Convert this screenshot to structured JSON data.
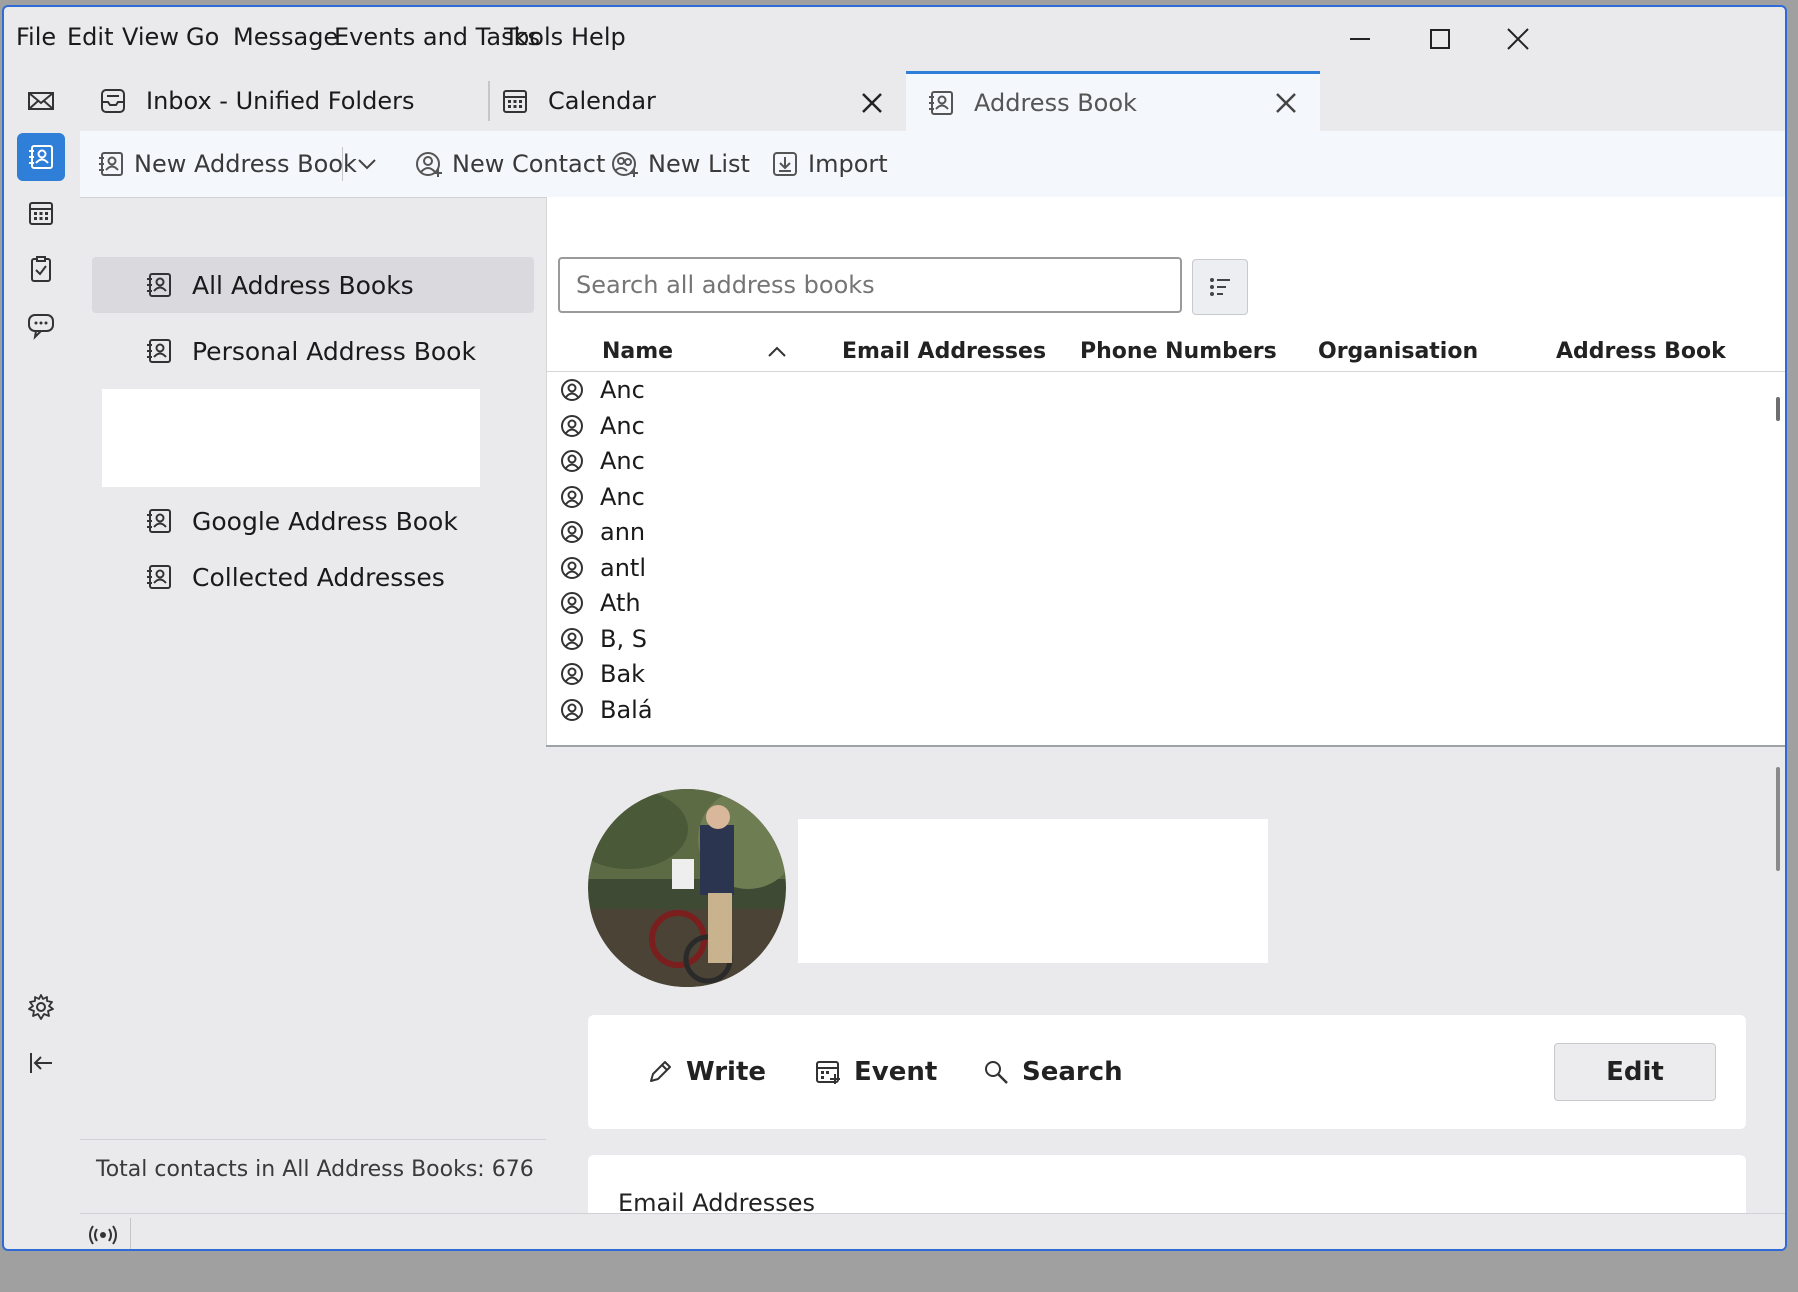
{
  "menu": {
    "items": [
      {
        "label": "File"
      },
      {
        "label": "Edit"
      },
      {
        "label": "View"
      },
      {
        "label": "Go"
      },
      {
        "label": "Message"
      },
      {
        "label": "Events and Tasks"
      },
      {
        "label": "Tools"
      },
      {
        "label": "Help"
      }
    ]
  },
  "tabs": [
    {
      "label": "Inbox - Unified Folders",
      "icon": "inbox-icon"
    },
    {
      "label": "Calendar",
      "icon": "calendar-icon"
    },
    {
      "label": "Address Book",
      "icon": "address-book-icon",
      "active": true
    }
  ],
  "toolbar": {
    "new_address_book": "New Address Book",
    "new_contact": "New Contact",
    "new_list": "New List",
    "import": "Import"
  },
  "sidebar": {
    "books": [
      {
        "label": "All Address Books",
        "selected": true
      },
      {
        "label": "Personal Address Book"
      },
      {
        "label": "Google Address Book"
      },
      {
        "label": "Collected Addresses"
      }
    ],
    "footer": "Total contacts in All Address Books: 676"
  },
  "search": {
    "placeholder": "Search all address books"
  },
  "table": {
    "columns": [
      "Name",
      "Email Addresses",
      "Phone Numbers",
      "Organisation",
      "Address Book"
    ],
    "rows": [
      {
        "name": "Anc"
      },
      {
        "name": "Anc"
      },
      {
        "name": "Anc"
      },
      {
        "name": "Anc"
      },
      {
        "name": "ann"
      },
      {
        "name": "antl"
      },
      {
        "name": "Ath"
      },
      {
        "name": "B, S"
      },
      {
        "name": "Bak"
      },
      {
        "name": "Balá"
      }
    ]
  },
  "detail": {
    "actions": {
      "write": "Write",
      "event": "Event",
      "search": "Search",
      "edit": "Edit"
    },
    "email_heading": "Email Addresses"
  },
  "colors": {
    "accent": "#2f7fd8",
    "window_border": "#2f6bd8"
  }
}
